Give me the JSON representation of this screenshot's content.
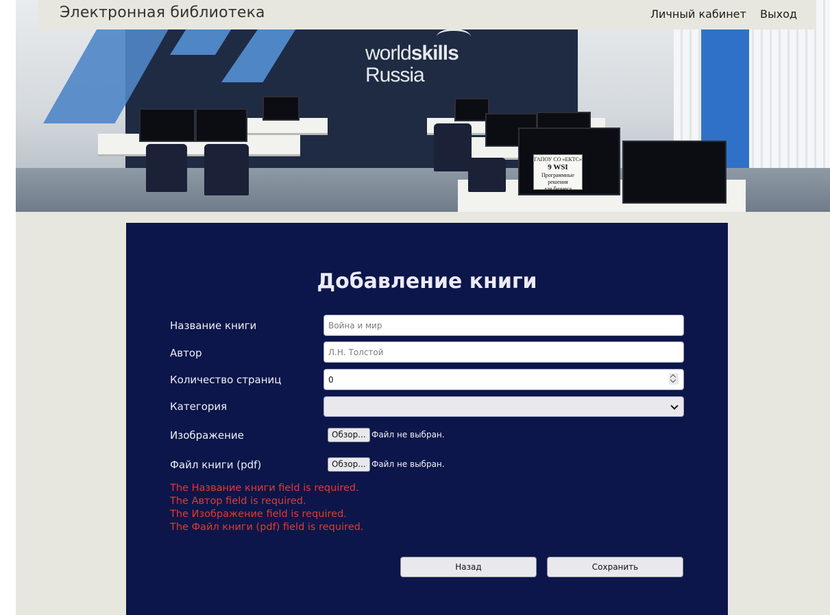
{
  "header": {
    "brand": "Электронная библиотека",
    "nav": {
      "account": "Личный кабинет",
      "logout": "Выход"
    }
  },
  "hero": {
    "logo_world": "world",
    "logo_skills": "skills",
    "logo_country": "Russia",
    "sign_lines": [
      "ГАПОУ СО «ЕКТС»",
      "9 WSI",
      "Программные решения",
      "для бизнеса"
    ]
  },
  "form": {
    "title": "Добавление книги",
    "fields": {
      "name_label": "Название книги",
      "name_placeholder": "Война и мир",
      "author_label": "Автор",
      "author_placeholder": "Л.Н. Толстой",
      "pages_label": "Количество страниц",
      "pages_value": "0",
      "category_label": "Категория",
      "category_value": "",
      "image_label": "Изображение",
      "pdf_label": "Файл книги (pdf)",
      "browse_label": "Обзор...",
      "no_file": "Файл не выбран."
    },
    "errors": [
      "The Название книги field is required.",
      "The Автор field is required.",
      "The Изображение field is required.",
      "The Файл книги (pdf) field is required."
    ],
    "buttons": {
      "back": "Назад",
      "save": "Сохранить"
    }
  },
  "colors": {
    "panel_bg": "#0c164a",
    "page_bg": "#e8e7df",
    "error": "#e23b31"
  }
}
